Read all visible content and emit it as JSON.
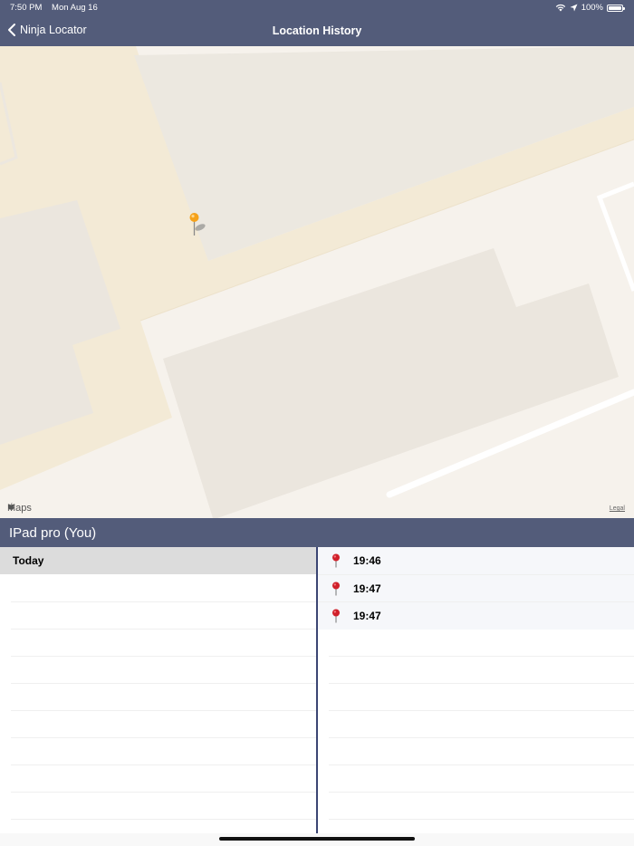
{
  "status_bar": {
    "time": "7:50 PM",
    "date": "Mon Aug 16",
    "battery": "100%",
    "icons": [
      "wifi-icon",
      "location-arrow-icon",
      "battery-icon"
    ]
  },
  "nav": {
    "back_label": "Ninja Locator",
    "title": "Location History"
  },
  "map": {
    "attribution": "Maps",
    "legal": "Legal",
    "pin_color": "#f5a11a",
    "colors": {
      "ground": "#f6f2ec",
      "road": "#f3ead6",
      "building": "#ebe6de"
    }
  },
  "device": {
    "name": "IPad pro (You)"
  },
  "days": [
    {
      "label": "Today"
    }
  ],
  "locations": [
    {
      "time": "19:46"
    },
    {
      "time": "19:47"
    },
    {
      "time": "19:47"
    }
  ],
  "colors": {
    "header": "#535c7a",
    "divider": "#3b4573",
    "selected_row": "#dcdcdc",
    "pin_red": "#d0202a"
  }
}
